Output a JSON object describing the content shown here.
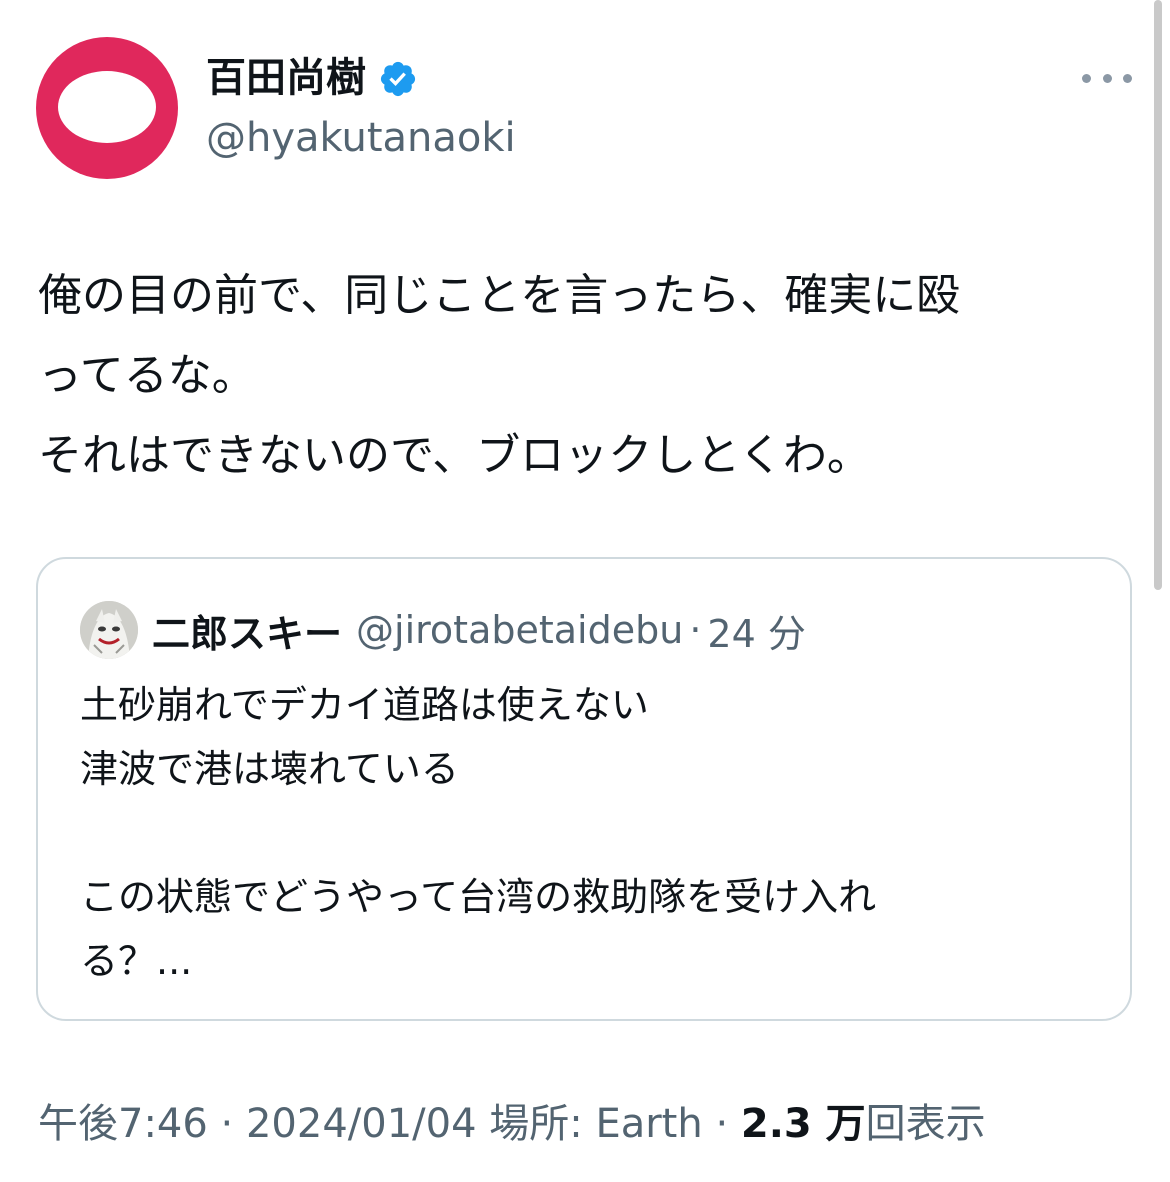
{
  "author": {
    "name": "百田尚樹",
    "handle": "@hyakutanaoki",
    "avatar_color": "#e0285c",
    "verified_badge_color": "#1d9bf0"
  },
  "icons": {
    "more": "more-horizontal-icon",
    "verified": "verified-badge-icon"
  },
  "tweet": {
    "lines": [
      "俺の目の前で、同じことを言ったら、確実に殴",
      "ってるな。",
      "それはできないので、ブロックしとくわ。"
    ]
  },
  "quote": {
    "name": "二郎スキー",
    "handle": "@jirotabetaidebu",
    "separator": "·",
    "time": "24 分",
    "lines": [
      "土砂崩れでデカイ道路は使えない",
      "津波で港は壊れている",
      "",
      "この状態でどうやって台湾の救助隊を受け入れ",
      "る？..."
    ]
  },
  "meta": {
    "time": "午後7:46",
    "separator": "·",
    "date": "2024/01/04",
    "location": "場所: Earth",
    "views_count": "2.3 万",
    "views_label": "回表示"
  }
}
